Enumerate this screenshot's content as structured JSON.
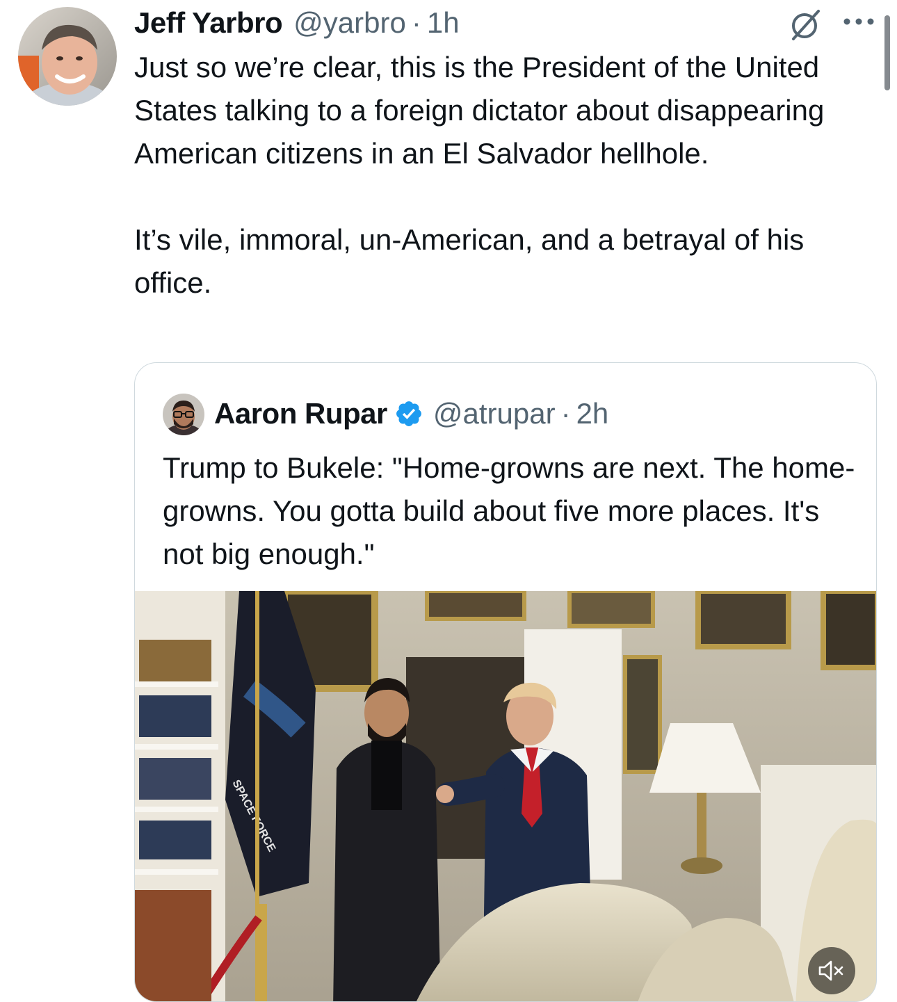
{
  "tweet": {
    "author_name": "Jeff Yarbro",
    "handle": "@yarbro",
    "separator": "·",
    "time": "1h",
    "text": "Just so we’re clear, this is the President of the United States talking to a foreign dictator about disappearing American citizens in an El Salvador hellhole.\n\nIt’s vile, immoral, un-American, and a betrayal of his office."
  },
  "quote": {
    "author_name": "Aaron Rupar",
    "verified": true,
    "handle": "@atrupar",
    "separator": "·",
    "time": "2h",
    "text": "Trump to Bukele: \"Home-growns are next. The home-growns. You gotta build about five more places. It's not big enough.\"",
    "media": {
      "type": "video",
      "flag_text": "SPACE FORCE",
      "muted": true
    }
  },
  "icons": {
    "grok": "grok-icon",
    "more": "more-options-icon",
    "verified": "verified-badge-icon",
    "mute": "speaker-muted-icon"
  },
  "colors": {
    "text_primary": "#0f1419",
    "text_secondary": "#536471",
    "border": "#cfd9de",
    "verified_blue": "#1d9bf0"
  }
}
